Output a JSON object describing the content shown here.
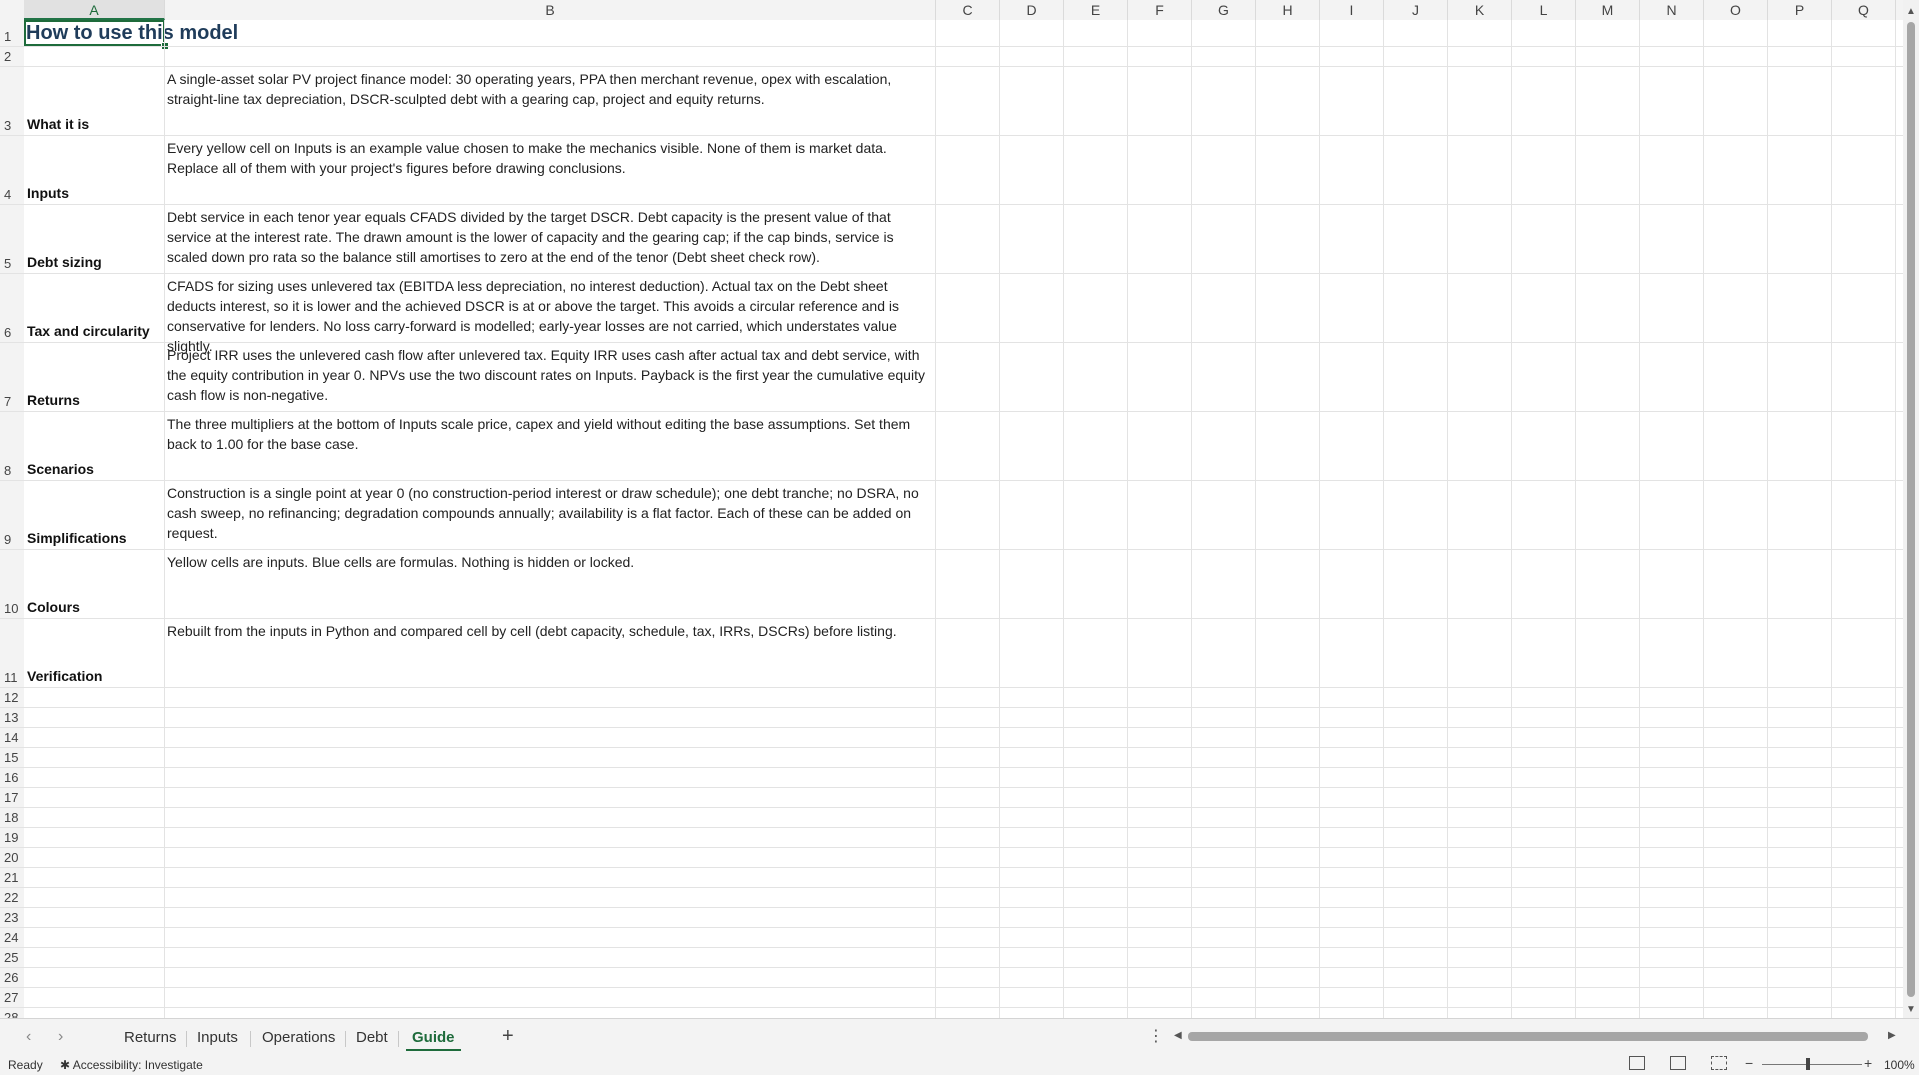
{
  "columns": [
    "A",
    "B",
    "C",
    "D",
    "E",
    "F",
    "G",
    "H",
    "I",
    "J",
    "K",
    "L",
    "M",
    "N",
    "O",
    "P",
    "Q"
  ],
  "rows": [
    "1",
    "2",
    "3",
    "4",
    "5",
    "6",
    "7",
    "8",
    "9",
    "10",
    "11",
    "12",
    "13",
    "14",
    "15",
    "16",
    "17",
    "18",
    "19",
    "20",
    "21",
    "22",
    "23",
    "24",
    "25",
    "26",
    "27",
    "28"
  ],
  "sheet": {
    "title": "How to use this model",
    "entries": [
      {
        "label": "What it is",
        "text": "A single-asset solar PV project finance model: 30 operating years, PPA then merchant revenue, opex with escalation, straight-line tax depreciation, DSCR-sculpted debt with a gearing cap, project and equity returns."
      },
      {
        "label": "Inputs",
        "text": "Every yellow cell on Inputs is an example value chosen to make the mechanics visible. None of them is market data. Replace all of them with your project's figures before drawing conclusions."
      },
      {
        "label": "Debt sizing",
        "text": "Debt service in each tenor year equals CFADS divided by the target DSCR. Debt capacity is the present value of that service at the interest rate. The drawn amount is the lower of capacity and the gearing cap; if the cap binds, service is scaled down pro rata so the balance still amortises to zero at the end of the tenor (Debt sheet check row)."
      },
      {
        "label": "Tax and circularity",
        "text": "CFADS for sizing uses unlevered tax (EBITDA less depreciation, no interest deduction). Actual tax on the Debt sheet deducts interest, so it is lower and the achieved DSCR is at or above the target. This avoids a circular reference and is conservative for lenders. No loss carry-forward is modelled; early-year losses are not carried, which understates value slightly."
      },
      {
        "label": "Returns",
        "text": "Project IRR uses the unlevered cash flow after unlevered tax. Equity IRR uses cash after actual tax and debt service, with the equity contribution in year 0. NPVs use the two discount rates on Inputs. Payback is the first year the cumulative equity cash flow is non-negative."
      },
      {
        "label": "Scenarios",
        "text": "The three multipliers at the bottom of Inputs scale price, capex and yield without editing the base assumptions. Set them back to 1.00 for the base case."
      },
      {
        "label": "Simplifications",
        "text": "Construction is a single point at year 0 (no construction-period interest or draw schedule); one debt tranche; no DSRA, no cash sweep, no refinancing; degradation compounds annually; availability is a flat factor. Each of these can be added on request."
      },
      {
        "label": "Colours",
        "text": "Yellow cells are inputs. Blue cells are formulas. Nothing is hidden or locked."
      },
      {
        "label": "Verification",
        "text": "Rebuilt from the inputs in Python and compared cell by cell (debt capacity, schedule, tax, IRRs, DSCRs) before listing."
      }
    ]
  },
  "tabs": {
    "items": [
      "Returns",
      "Inputs",
      "Operations",
      "Debt",
      "Guide"
    ],
    "active": "Guide",
    "add": "+",
    "more": "⋮"
  },
  "status": {
    "ready": "Ready",
    "accessibility": "Accessibility: Investigate",
    "zoom_minus": "−",
    "zoom_plus": "+",
    "zoom": "100%"
  },
  "colors": {
    "accent": "#217346",
    "title": "#1f3c5a"
  }
}
